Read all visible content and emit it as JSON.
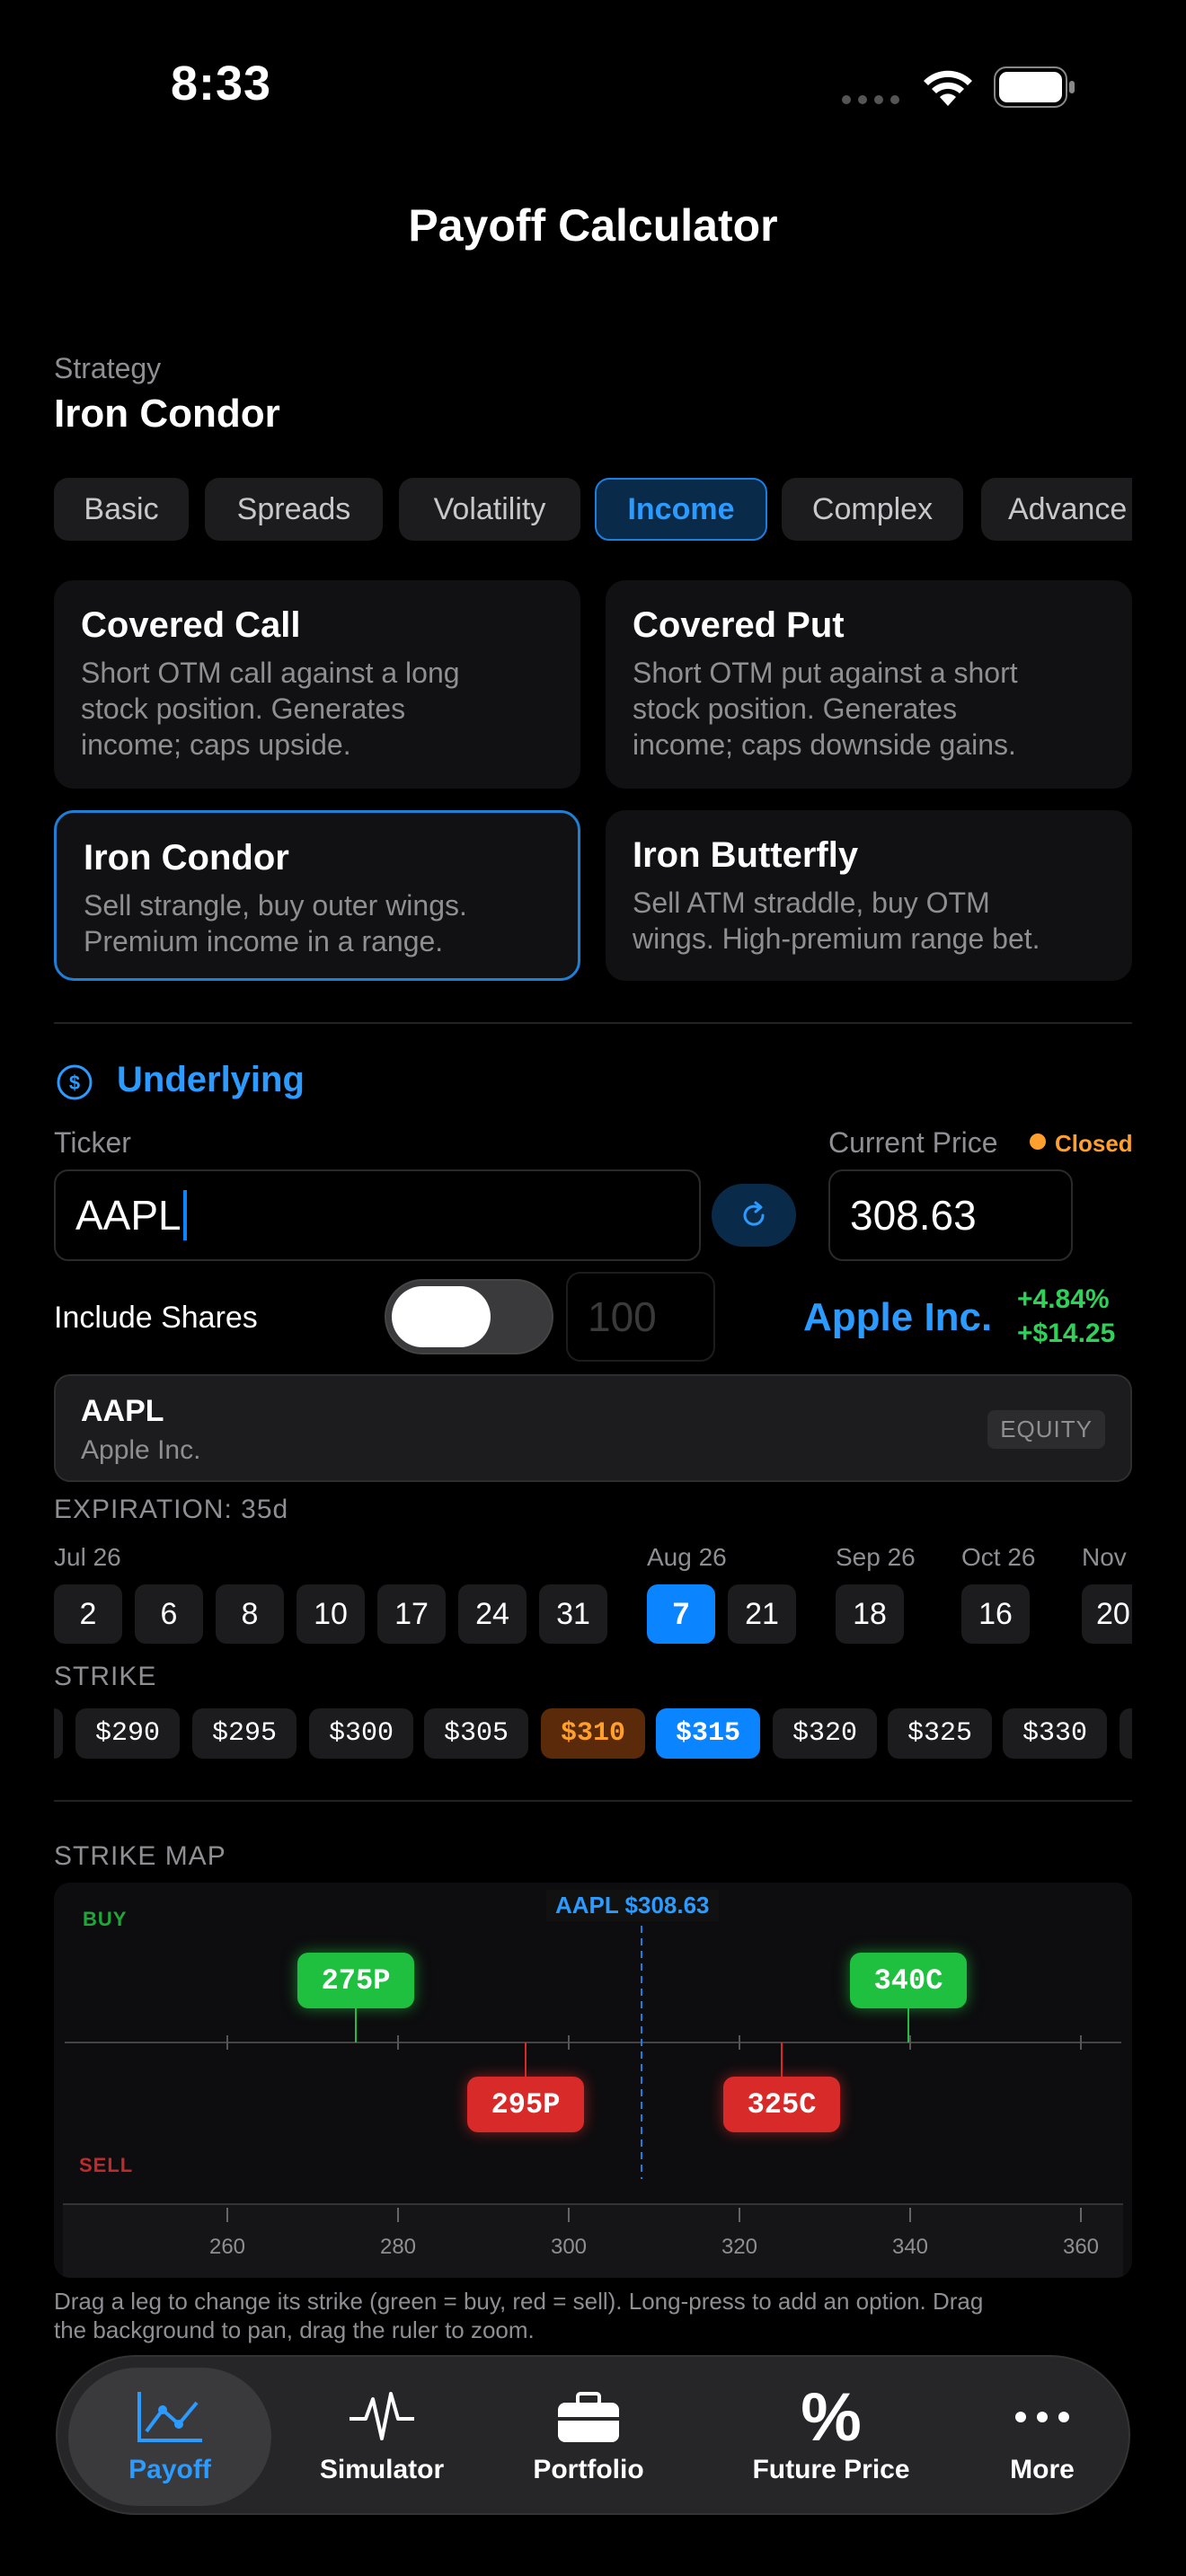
{
  "status": {
    "time": "8:33"
  },
  "nav": {
    "title": "Payoff Calculator"
  },
  "strategy": {
    "label": "Strategy",
    "value": "Iron Condor"
  },
  "categories": [
    "Basic",
    "Spreads",
    "Volatility",
    "Income",
    "Complex",
    "Advance"
  ],
  "active_category": "Income",
  "cards": [
    {
      "title": "Covered Call",
      "desc1": "Short OTM call against a long",
      "desc2": "stock position. Generates",
      "desc3": "income; caps upside."
    },
    {
      "title": "Covered Put",
      "desc1": "Short OTM put against a short",
      "desc2": "stock position. Generates",
      "desc3": "income; caps downside gains."
    },
    {
      "title": "Iron Condor",
      "desc1": "Sell strangle, buy outer wings.",
      "desc2": "Premium income in a range."
    },
    {
      "title": "Iron Butterfly",
      "desc1": "Sell ATM straddle, buy OTM",
      "desc2": "wings. High-premium range bet."
    }
  ],
  "underlying": {
    "section_title": "Underlying",
    "ticker_label": "Ticker",
    "ticker_value": "AAPL",
    "price_label": "Current Price",
    "market_status": "Closed",
    "price_value": "308.63",
    "include_shares_label": "Include Shares",
    "shares_placeholder": "100",
    "company_name": "Apple Inc.",
    "change_pct": "+4.84%",
    "change_abs": "+$14.25",
    "result_symbol": "AAPL",
    "result_name": "Apple Inc.",
    "result_type": "EQUITY"
  },
  "expiration": {
    "label": "EXPIRATION: 35d",
    "months": [
      "Jul 26",
      "Aug 26",
      "Sep 26",
      "Oct 26",
      "Nov"
    ],
    "dates": [
      "2",
      "6",
      "8",
      "10",
      "17",
      "24",
      "31",
      "7",
      "21",
      "18",
      "16",
      "20"
    ]
  },
  "strike": {
    "label": "STRIKE",
    "values": [
      "$290",
      "$295",
      "$300",
      "$305",
      "$310",
      "$315",
      "$320",
      "$325",
      "$330"
    ]
  },
  "strike_map": {
    "label": "STRIKE MAP",
    "buy_label": "BUY",
    "sell_label": "SELL",
    "price_marker": "AAPL $308.63",
    "legs": {
      "buy1": "275P",
      "buy2": "340C",
      "sell1": "295P",
      "sell2": "325C"
    },
    "axis": [
      "260",
      "280",
      "300",
      "320",
      "340",
      "360"
    ],
    "hint": "Drag a leg to change its strike (green = buy, red = sell). Long-press to add an option. Drag",
    "hint2": "the background to pan, drag the ruler to zoom."
  },
  "tabs": [
    "Payoff",
    "Simulator",
    "Portfolio",
    "Future Price",
    "More"
  ],
  "colors": {
    "accent": "#0a84ff",
    "buy": "#1fbf3f",
    "sell": "#d92a2a",
    "closed": "#ff9f2e"
  }
}
